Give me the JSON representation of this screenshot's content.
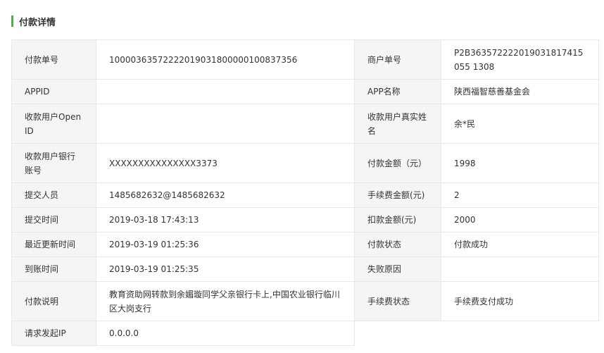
{
  "section": {
    "title": "付款详情",
    "accent_color": "#4caf50"
  },
  "rows": [
    {
      "label1": "付款单号",
      "value1": "10000363572222019031800000100837356",
      "label2": "商户单号",
      "value2": "P2B363572222019031817415055 1308"
    },
    {
      "label1": "APPID",
      "value1": "",
      "label2": "APP名称",
      "value2": "陕西福智慈善基金会"
    },
    {
      "label1": "收款用户Open ID",
      "value1": "",
      "label2": "收款用户真实姓名",
      "value2": "余*民"
    },
    {
      "label1": "收款用户银行账号",
      "value1": "XXXXXXXXXXXXXXX3373",
      "label2": "付款金额（元）",
      "value2": "1998"
    },
    {
      "label1": "提交人员",
      "value1": "1485682632@1485682632",
      "label2": "手续费金额(元)",
      "value2": "2"
    },
    {
      "label1": "提交时间",
      "value1": "2019-03-18 17:43:13",
      "label2": "扣款金额(元)",
      "value2": "2000"
    },
    {
      "label1": "最近更新时间",
      "value1": "2019-03-19 01:25:36",
      "label2": "付款状态",
      "value2": "付款成功"
    },
    {
      "label1": "到账时间",
      "value1": "2019-03-19 01:25:35",
      "label2": "失败原因",
      "value2": ""
    },
    {
      "label1": "付款说明",
      "value1": "教育资助网转款到余媚璇同学父亲银行卡上,中国农业银行临川区大岗支行",
      "label2": "手续费状态",
      "value2": "手续费支付成功"
    },
    {
      "label1": "请求发起IP",
      "value1": "0.0.0.0"
    }
  ]
}
